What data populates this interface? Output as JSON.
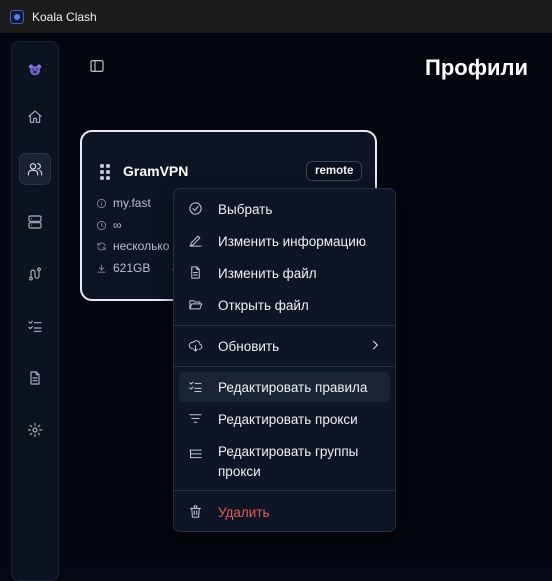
{
  "window": {
    "title": "Koala Clash"
  },
  "page": {
    "title": "Профили"
  },
  "sidebar": {
    "items": [
      {
        "name": "home",
        "icon": "home-icon",
        "active": false
      },
      {
        "name": "profiles",
        "icon": "users-icon",
        "active": true
      },
      {
        "name": "proxies",
        "icon": "server-icon",
        "active": false
      },
      {
        "name": "connections",
        "icon": "route-icon",
        "active": false
      },
      {
        "name": "rules",
        "icon": "list-checks-icon",
        "active": false
      },
      {
        "name": "logs",
        "icon": "file-text-icon",
        "active": false
      },
      {
        "name": "settings",
        "icon": "gear-icon",
        "active": false
      }
    ]
  },
  "profile_card": {
    "name": "GramVPN",
    "badge": "remote",
    "host": "my.fast",
    "expire": "∞",
    "updated": "несколько",
    "traffic": "621GB"
  },
  "context_menu": {
    "items": [
      {
        "label": "Выбрать",
        "icon": "circle-check-icon"
      },
      {
        "label": "Изменить информацию",
        "icon": "pencil-icon"
      },
      {
        "label": "Изменить файл",
        "icon": "file-icon"
      },
      {
        "label": "Открыть файл",
        "icon": "folder-open-icon"
      },
      {
        "label": "Обновить",
        "icon": "cloud-download-icon",
        "submenu": true
      },
      {
        "label": "Редактировать правила",
        "icon": "list-checks-icon",
        "highlighted": true
      },
      {
        "label": "Редактировать прокси",
        "icon": "filter-icon"
      },
      {
        "label": "Редактировать группы прокси",
        "icon": "list-tree-icon"
      },
      {
        "label": "Удалить",
        "icon": "trash-icon",
        "danger": true
      }
    ]
  },
  "colors": {
    "danger": "#e05a5a",
    "background": "#04070f",
    "card_border": "#e8ebf2"
  }
}
